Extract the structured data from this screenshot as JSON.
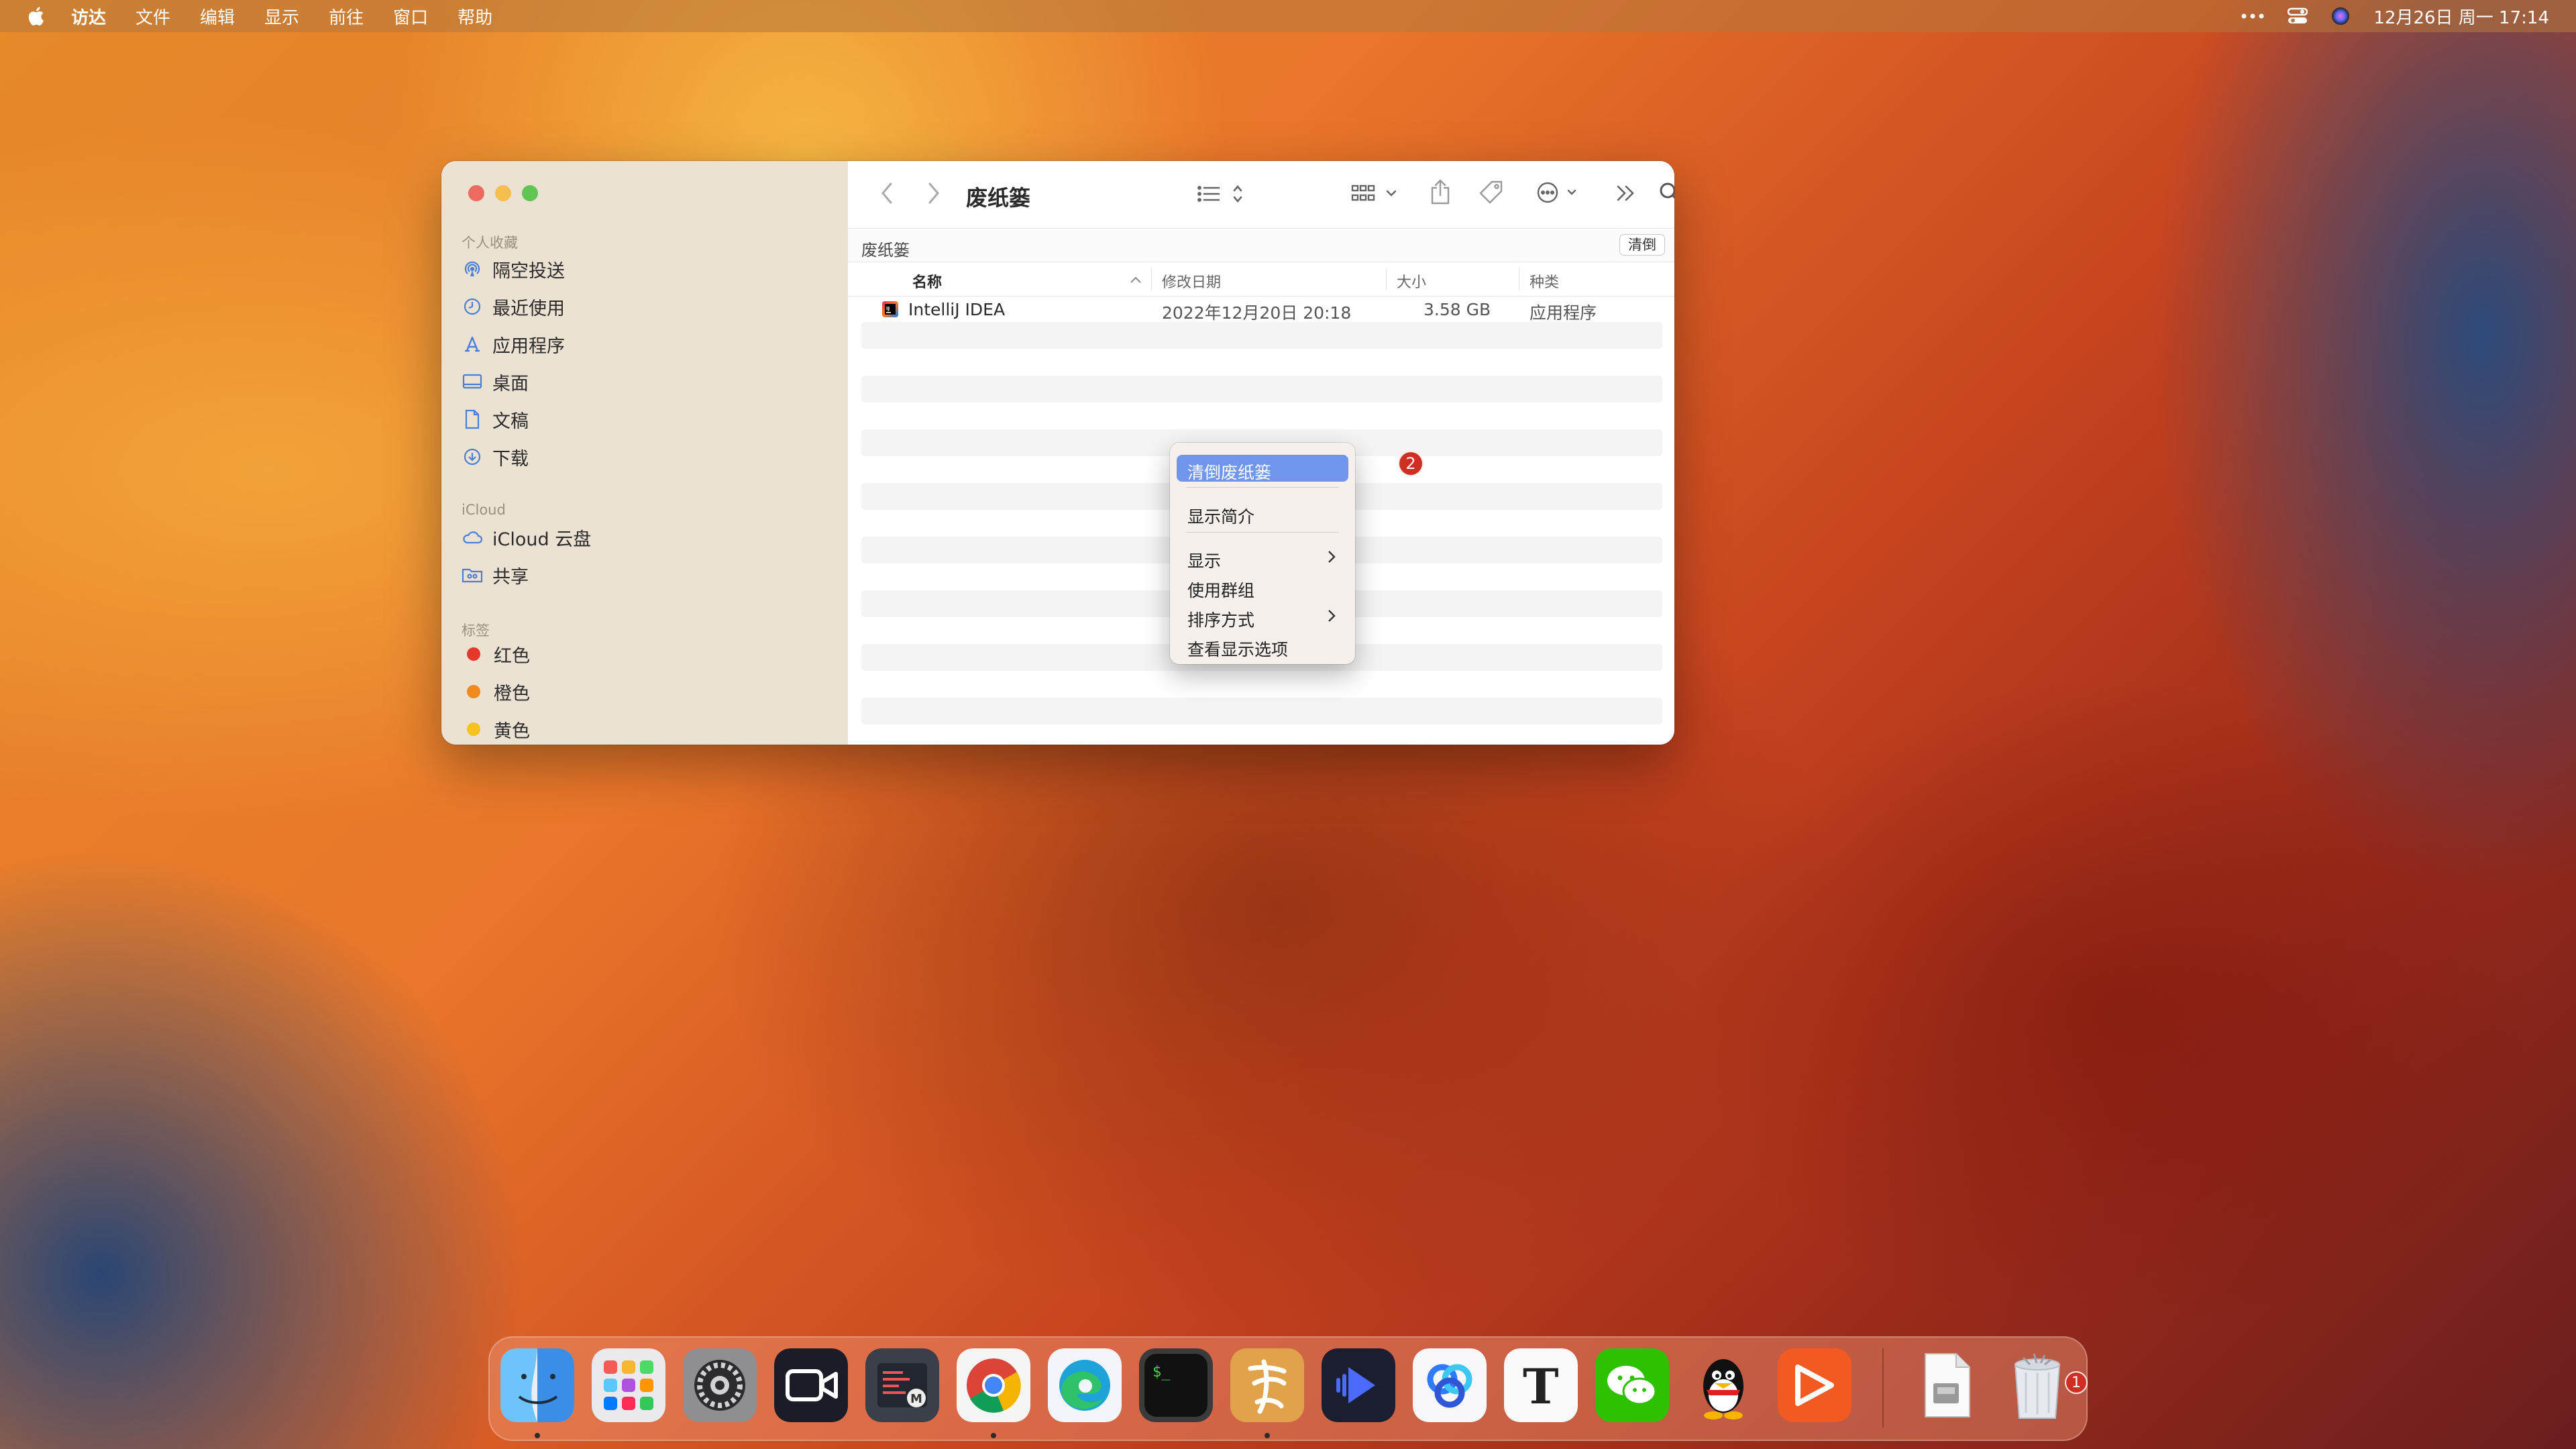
{
  "menubar": {
    "app_name": "访达",
    "items": [
      "文件",
      "编辑",
      "显示",
      "前往",
      "窗口",
      "帮助"
    ],
    "datetime": "12月26日 周一  17:14"
  },
  "finder": {
    "title": "废纸篓",
    "path_label": "废纸篓",
    "empty_button": "清倒",
    "sidebar": {
      "favorites_header": "个人收藏",
      "favorites": [
        {
          "label": "隔空投送",
          "icon": "airdrop-icon"
        },
        {
          "label": "最近使用",
          "icon": "clock-icon"
        },
        {
          "label": "应用程序",
          "icon": "applications-icon"
        },
        {
          "label": "桌面",
          "icon": "desktop-icon"
        },
        {
          "label": "文稿",
          "icon": "document-icon"
        },
        {
          "label": "下载",
          "icon": "download-icon"
        }
      ],
      "icloud_header": "iCloud",
      "icloud": [
        {
          "label": "iCloud 云盘",
          "icon": "cloud-icon"
        },
        {
          "label": "共享",
          "icon": "shared-folder-icon"
        }
      ],
      "tags_header": "标签",
      "tags": [
        {
          "label": "红色",
          "color": "#e5372a"
        },
        {
          "label": "橙色",
          "color": "#f08a1c"
        },
        {
          "label": "黄色",
          "color": "#f5c21e"
        }
      ]
    },
    "columns": {
      "name": "名称",
      "date": "修改日期",
      "size": "大小",
      "kind": "种类"
    },
    "files": [
      {
        "name": "IntelliJ IDEA",
        "date": "2022年12月20日 20:18",
        "size": "3.58 GB",
        "kind": "应用程序"
      }
    ]
  },
  "context_menu": {
    "items": {
      "empty_trash": "清倒废纸篓",
      "get_info": "显示简介",
      "show": "显示",
      "use_groups": "使用群组",
      "sort_by": "排序方式",
      "view_options": "查看显示选项"
    }
  },
  "annotation_badge": "2",
  "dock": {
    "trash_badge": "1",
    "apps": [
      "finder-icon",
      "launchpad-icon",
      "system-settings-icon",
      "facetime-icon",
      "bbedit-icon",
      "chrome-icon",
      "edge-icon",
      "terminal-icon",
      "calligraphy-app-icon",
      "infuse-icon",
      "baidu-netdisk-icon",
      "typora-icon",
      "wechat-icon",
      "qq-icon",
      "presentation-app-icon",
      "file-icon",
      "trash-icon"
    ]
  },
  "colors": {
    "selection_blue": "#6f96ea",
    "badge_red": "#cf2f22"
  }
}
